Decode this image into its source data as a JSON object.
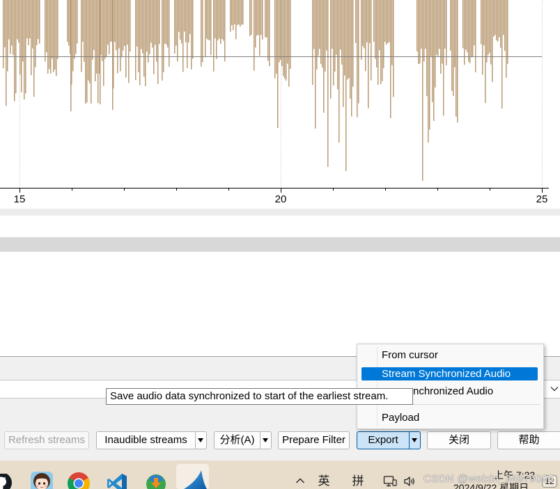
{
  "colors": {
    "waveform": "#b99b74",
    "accent": "#0078d7",
    "pressed_button": "#cce4f7",
    "taskbar": "#e8dccb"
  },
  "waveform": {
    "tick_labels": [
      "15",
      "20",
      "25"
    ]
  },
  "export_menu": {
    "items": [
      {
        "label": "From cursor"
      },
      {
        "label": "Stream Synchronized Audio",
        "highlighted": true
      },
      {
        "label": "nchronized Audio"
      },
      {
        "label": "Payload"
      }
    ]
  },
  "tooltip": {
    "text": "Save audio data synchronized to start of the earliest stream."
  },
  "buttons": {
    "refresh_streams": {
      "label": "Refresh streams",
      "enabled": false
    },
    "inaudible_streams": {
      "label": "Inaudible streams",
      "has_menu": true
    },
    "analyze": {
      "label": "分析(A)",
      "has_menu": true
    },
    "prepare_filter": {
      "label": "Prepare Filter"
    },
    "export": {
      "label": "Export",
      "has_menu": true,
      "pressed": true
    },
    "close": {
      "label": "关闭"
    },
    "help": {
      "label": "帮助"
    }
  },
  "taskbar": {
    "pinned_apps": [
      {
        "icon": "github-icon"
      },
      {
        "icon": "avatar-app-icon"
      },
      {
        "icon": "chrome-icon"
      },
      {
        "icon": "vscode-icon"
      },
      {
        "icon": "download-manager-icon"
      },
      {
        "icon": "wireshark-icon",
        "active": true
      }
    ],
    "tray": {
      "overflow_icon": "chevron-up-icon",
      "input_language": "英",
      "input_mode": "拼",
      "status_icons": [
        "network-icon",
        "speaker-icon"
      ],
      "time": "上午 7:22",
      "date": "2024/9/22 星期日",
      "notification_count": "12"
    }
  },
  "watermark": "CSDN @weixin_34979095"
}
